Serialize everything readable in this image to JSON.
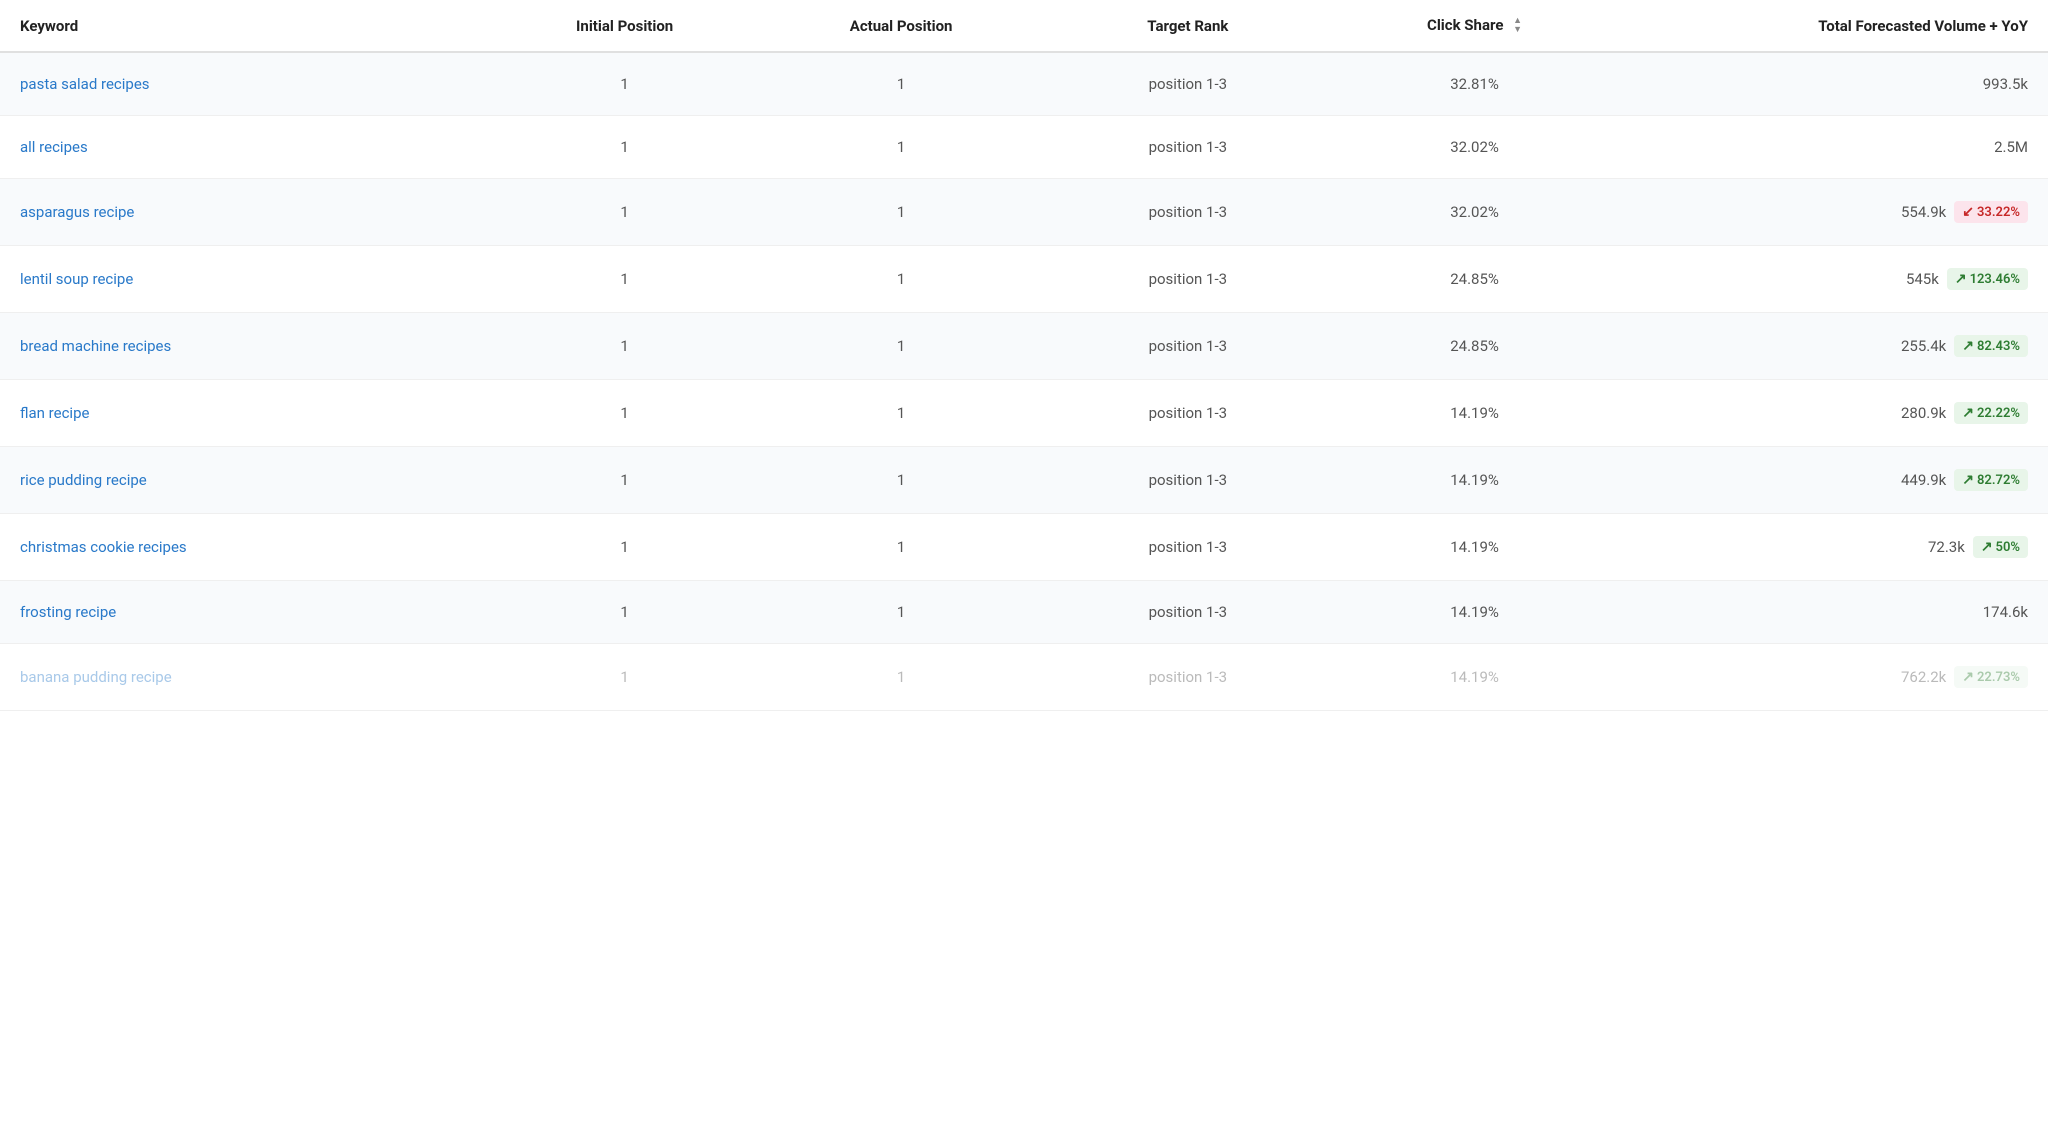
{
  "table": {
    "headers": {
      "keyword": "Keyword",
      "initial_position": "Initial Position",
      "actual_position": "Actual Position",
      "target_rank": "Target Rank",
      "click_share": "Click Share",
      "forecast": "Total Forecasted Volume + YoY"
    },
    "rows": [
      {
        "keyword": "pasta salad recipes",
        "initial_position": "1",
        "actual_position": "1",
        "target_rank": "position 1-3",
        "click_share": "32.81%",
        "forecast_num": "993.5k",
        "badge": null
      },
      {
        "keyword": "all recipes",
        "initial_position": "1",
        "actual_position": "1",
        "target_rank": "position 1-3",
        "click_share": "32.02%",
        "forecast_num": "2.5M",
        "badge": null
      },
      {
        "keyword": "asparagus recipe",
        "initial_position": "1",
        "actual_position": "1",
        "target_rank": "position 1-3",
        "click_share": "32.02%",
        "forecast_num": "554.9k",
        "badge": {
          "type": "red",
          "text": "33.22%"
        }
      },
      {
        "keyword": "lentil soup recipe",
        "initial_position": "1",
        "actual_position": "1",
        "target_rank": "position 1-3",
        "click_share": "24.85%",
        "forecast_num": "545k",
        "badge": {
          "type": "green",
          "text": "123.46%"
        }
      },
      {
        "keyword": "bread machine recipes",
        "initial_position": "1",
        "actual_position": "1",
        "target_rank": "position 1-3",
        "click_share": "24.85%",
        "forecast_num": "255.4k",
        "badge": {
          "type": "green",
          "text": "82.43%"
        }
      },
      {
        "keyword": "flan recipe",
        "initial_position": "1",
        "actual_position": "1",
        "target_rank": "position 1-3",
        "click_share": "14.19%",
        "forecast_num": "280.9k",
        "badge": {
          "type": "green",
          "text": "22.22%"
        }
      },
      {
        "keyword": "rice pudding recipe",
        "initial_position": "1",
        "actual_position": "1",
        "target_rank": "position 1-3",
        "click_share": "14.19%",
        "forecast_num": "449.9k",
        "badge": {
          "type": "green",
          "text": "82.72%"
        }
      },
      {
        "keyword": "christmas cookie recipes",
        "initial_position": "1",
        "actual_position": "1",
        "target_rank": "position 1-3",
        "click_share": "14.19%",
        "forecast_num": "72.3k",
        "badge": {
          "type": "green",
          "text": "50%"
        }
      },
      {
        "keyword": "frosting recipe",
        "initial_position": "1",
        "actual_position": "1",
        "target_rank": "position 1-3",
        "click_share": "14.19%",
        "forecast_num": "174.6k",
        "badge": null
      },
      {
        "keyword": "banana pudding recipe",
        "initial_position": "1",
        "actual_position": "1",
        "target_rank": "position 1-3",
        "click_share": "14.19%",
        "forecast_num": "762.2k",
        "badge": {
          "type": "green",
          "text": "22.73%"
        },
        "faded": true
      }
    ]
  }
}
